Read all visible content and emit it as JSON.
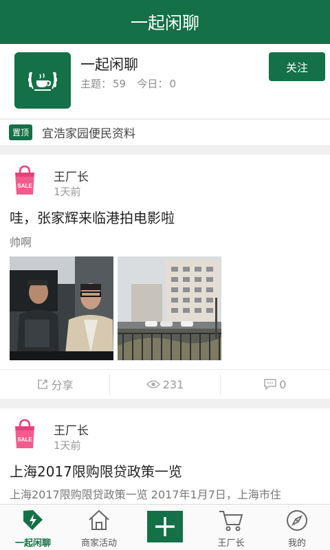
{
  "header": {
    "title": "一起闲聊"
  },
  "forum": {
    "name": "一起闲聊",
    "topics_label": "主题：",
    "topics": "59",
    "today_label": "今日：",
    "today": "0",
    "follow_label": "关注"
  },
  "pinned": {
    "badge": "置顶",
    "title": "宜浩家园便民资料"
  },
  "posts": [
    {
      "author": "王厂长",
      "time": "1天前",
      "title": "哇，张家辉来临港拍电影啦",
      "summary": "帅啊",
      "share_label": "分享",
      "views": "231",
      "comments": "0"
    },
    {
      "author": "王厂长",
      "time": "1天前",
      "title": "上海2017限购限贷政策一览",
      "summary": "上海2017限购限贷政策一览  2017年1月7日，上海市住"
    }
  ],
  "bottom_nav": [
    {
      "label": "一起闲聊",
      "icon": "tag-lightning-icon"
    },
    {
      "label": "商家活动",
      "icon": "home-icon"
    },
    {
      "label": "",
      "icon": "plus-icon"
    },
    {
      "label": "王厂长",
      "icon": "cart-icon"
    },
    {
      "label": "我的",
      "icon": "compass-icon"
    }
  ],
  "colors": {
    "brand": "#147046",
    "background": "#f0f0f0"
  }
}
